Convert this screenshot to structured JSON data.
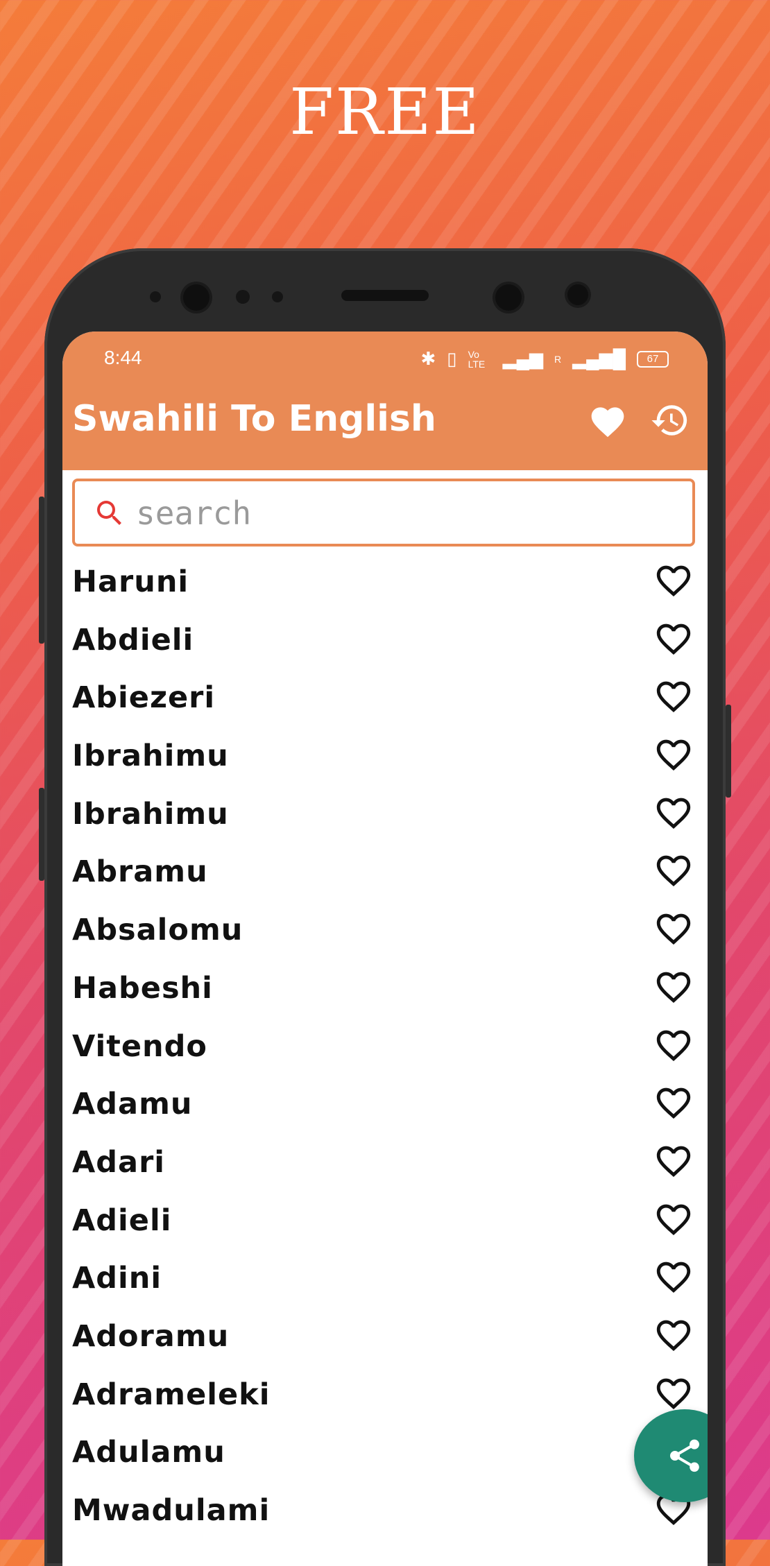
{
  "promo": {
    "title": "FREE"
  },
  "status_bar": {
    "time": "8:44",
    "battery": "67",
    "network_labels": [
      "Vo LTE",
      "R"
    ]
  },
  "app_bar": {
    "title": "Swahili To English",
    "favorites_icon": "heart-filled-icon",
    "history_icon": "history-icon"
  },
  "search": {
    "placeholder": "search",
    "value": "",
    "icon": "search-icon"
  },
  "words": [
    "Haruni",
    "Abdieli",
    "Abiezeri",
    "Ibrahimu",
    "Ibrahimu",
    "Abramu",
    "Absalomu",
    "Habeshi",
    "Vitendo",
    "Adamu",
    "Adari",
    "Adieli",
    "Adini",
    "Adoramu",
    "Adrameleki",
    "Adulamu",
    "Mwadulami"
  ],
  "fab": {
    "icon": "share-icon"
  },
  "colors": {
    "app_bar": "#e98a55",
    "search_border": "#e98a55",
    "search_icon": "#e53935",
    "fab": "#1f8a73",
    "text": "#111111"
  }
}
